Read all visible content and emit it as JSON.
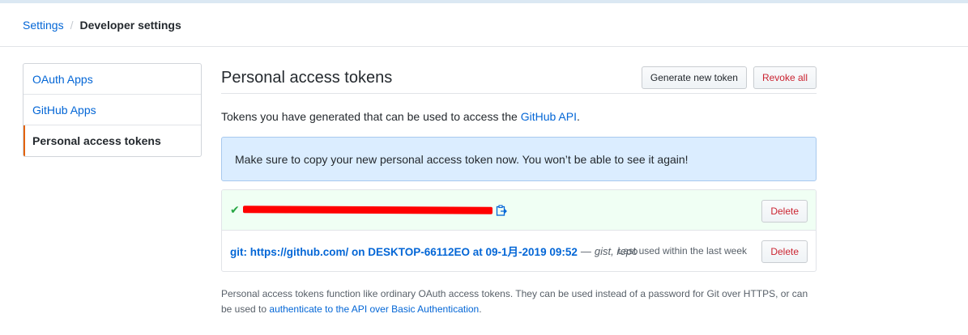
{
  "breadcrumb": {
    "parent": "Settings",
    "separator": "/",
    "current": "Developer settings"
  },
  "sidebar": {
    "items": [
      {
        "label": "OAuth Apps",
        "selected": false
      },
      {
        "label": "GitHub Apps",
        "selected": false
      },
      {
        "label": "Personal access tokens",
        "selected": true
      }
    ]
  },
  "main": {
    "title": "Personal access tokens",
    "generate_button": "Generate new token",
    "revoke_button": "Revoke all",
    "description_prefix": "Tokens you have generated that can be used to access the ",
    "description_link": "GitHub API",
    "description_suffix": ".",
    "flash_message": "Make sure to copy your new personal access token now. You won’t be able to see it again!"
  },
  "tokens": [
    {
      "type": "new",
      "value_redacted": true,
      "delete_label": "Delete"
    },
    {
      "type": "existing",
      "name": "git: https://github.com/ on DESKTOP-66112EO at 09-1月-2019 09:52",
      "dash": "—",
      "scopes": "gist, repo",
      "last_used": "Last used within the last week",
      "delete_label": "Delete"
    }
  ],
  "footnote": {
    "text": "Personal access tokens function like ordinary OAuth access tokens. They can be used instead of a password for Git over HTTPS, or can be used to ",
    "link": "authenticate to the API over Basic Authentication",
    "end": "."
  },
  "colors": {
    "link": "#0366d6",
    "danger": "#cb2431",
    "success": "#28a745",
    "flash_bg": "#dbedff",
    "selected_accent": "#e36209",
    "redaction": "#ff0000"
  }
}
